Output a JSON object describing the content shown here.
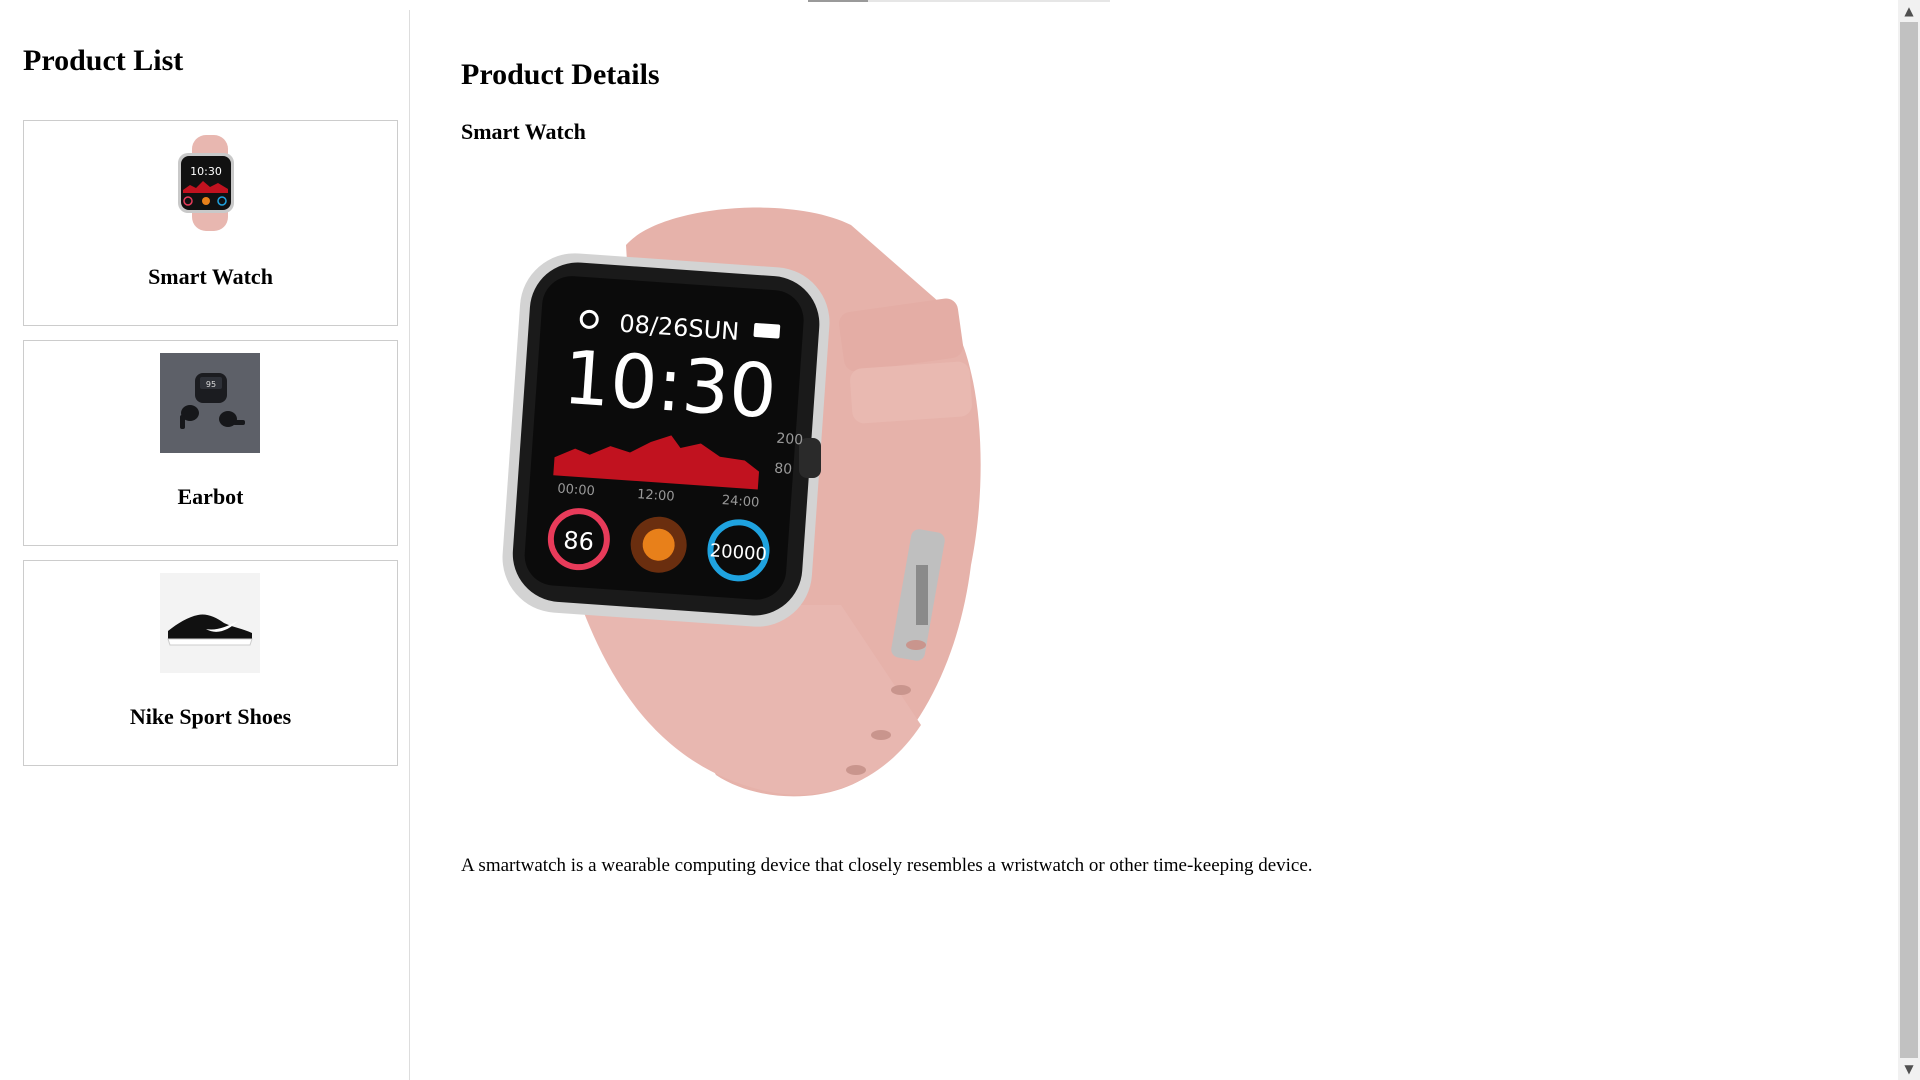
{
  "sidebar": {
    "title": "Product List",
    "products": [
      {
        "name": "Smart Watch",
        "icon": "smart-watch-image"
      },
      {
        "name": "Earbot",
        "icon": "earbuds-image"
      },
      {
        "name": "Nike Sport Shoes",
        "icon": "sport-shoe-image"
      }
    ]
  },
  "details": {
    "heading": "Product Details",
    "product_name": "Smart Watch",
    "description": "A smartwatch is a wearable computing device that closely resembles a wristwatch or other time-keeping device.",
    "watch_face": {
      "date": "08/26",
      "day": "SUN",
      "time": "10:30",
      "chart_max": "200",
      "chart_mid": "80",
      "t0": "00:00",
      "t1": "12:00",
      "t2": "24:00",
      "heart": "86",
      "steps": "20000"
    }
  },
  "colors": {
    "strap": "#e8b7b0",
    "accent_red": "#d11a2a",
    "accent_blue": "#1fa3e0",
    "accent_orange": "#e8801a"
  }
}
